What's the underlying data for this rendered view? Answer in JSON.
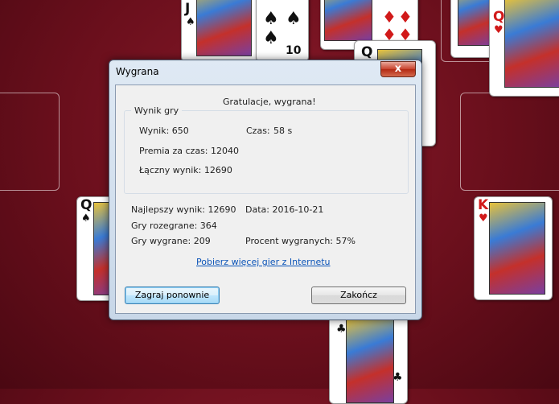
{
  "dialog": {
    "title": "Wygrana",
    "close_glyph": "x",
    "congrats": "Gratulacje, wygrana!",
    "group_title": "Wynik gry",
    "score_label": "Wynik: 650",
    "time_label": "Czas:",
    "time_value": "58 s",
    "bonus_label": "Premia za czas: 12040",
    "total_label": "Łączny wynik: 12690",
    "best_label": "Najlepszy wynik: 12690",
    "date_label": "Data: 2016-10-21",
    "played_label": "Gry rozegrane: 364",
    "won_label": "Gry wygrane: 209",
    "percent_label": "Procent wygranych: 57%",
    "more_games_link": "Pobierz więcej gier z Internetu",
    "play_again_button": "Zagraj ponownie",
    "exit_button": "Zakończ"
  },
  "cards": {
    "jack_spades": {
      "rank": "J",
      "suit": "♠"
    },
    "ten_spades": {
      "rank": "10",
      "suit": "♠"
    },
    "diamonds_top": {
      "rank": "",
      "suit": "♦"
    },
    "queen_hearts": {
      "rank": "Q",
      "suit": "♥"
    },
    "queen_hidden": {
      "rank": "Q",
      "suit": "♠"
    },
    "queen_spades_left": {
      "rank": "Q",
      "suit": "♠"
    },
    "king_hearts": {
      "rank": "K",
      "suit": "♥"
    },
    "clubs_bottom": {
      "rank": "",
      "suit": "♣"
    }
  },
  "colors": {
    "felt": "#6a0f1c",
    "close_red": "#c8422c",
    "link_blue": "#0b54b8"
  }
}
